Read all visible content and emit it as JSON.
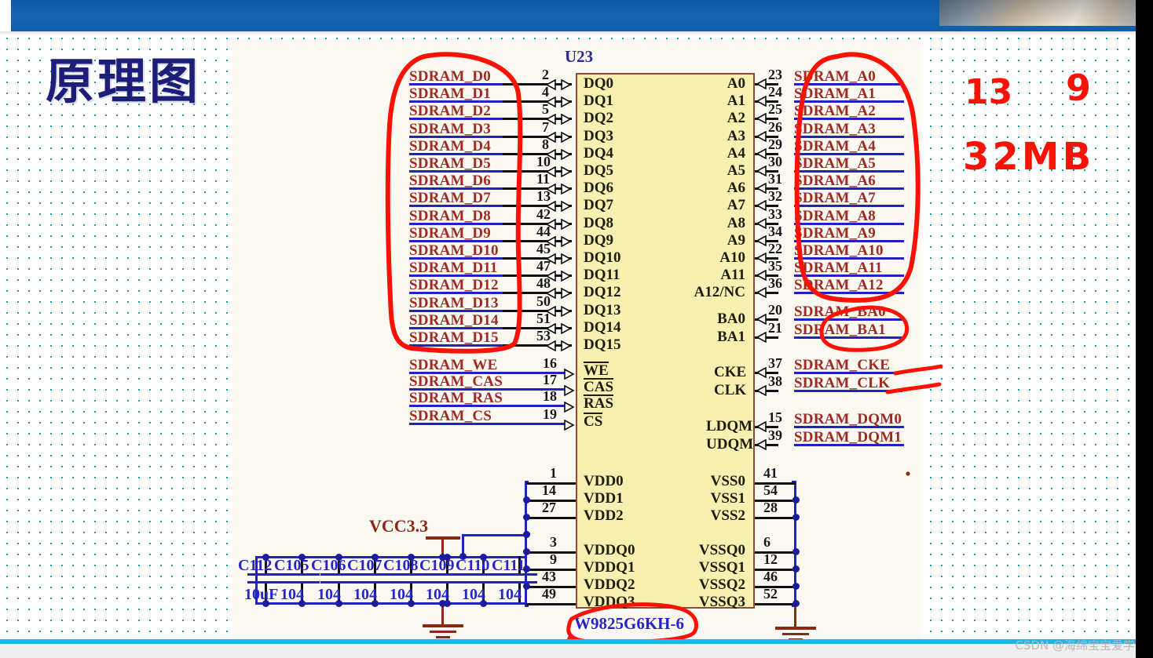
{
  "slide": {
    "title": "原理图",
    "chip_ref": "U23",
    "chip_part": "W9825G6KH-6",
    "power_rail": "VCC3.3",
    "gnd_left": "GND",
    "gnd_right": "GND"
  },
  "watermark": "CSDN @海绵宝宝爱学习",
  "colors": {
    "chip_fill": "#f7f0b0",
    "chip_border": "#8f4a38",
    "net_label": "#9e2a20",
    "wire_blue": "#2222c0",
    "annotation_red": "#fb1205",
    "title_blue": "#1c1e7a",
    "topbar_blue": "#1465b3",
    "progress_blue": "#22b3e8"
  },
  "data_bus": {
    "nets": [
      {
        "label": "SDRAM_D0",
        "pin": "2",
        "name": "DQ0"
      },
      {
        "label": "SDRAM_D1",
        "pin": "4",
        "name": "DQ1"
      },
      {
        "label": "SDRAM_D2",
        "pin": "5",
        "name": "DQ2"
      },
      {
        "label": "SDRAM_D3",
        "pin": "7",
        "name": "DQ3"
      },
      {
        "label": "SDRAM_D4",
        "pin": "8",
        "name": "DQ4"
      },
      {
        "label": "SDRAM_D5",
        "pin": "10",
        "name": "DQ5"
      },
      {
        "label": "SDRAM_D6",
        "pin": "11",
        "name": "DQ6"
      },
      {
        "label": "SDRAM_D7",
        "pin": "13",
        "name": "DQ7"
      },
      {
        "label": "SDRAM_D8",
        "pin": "42",
        "name": "DQ8"
      },
      {
        "label": "SDRAM_D9",
        "pin": "44",
        "name": "DQ9"
      },
      {
        "label": "SDRAM_D10",
        "pin": "45",
        "name": "DQ10"
      },
      {
        "label": "SDRAM_D11",
        "pin": "47",
        "name": "DQ11"
      },
      {
        "label": "SDRAM_D12",
        "pin": "48",
        "name": "DQ12"
      },
      {
        "label": "SDRAM_D13",
        "pin": "50",
        "name": "DQ13"
      },
      {
        "label": "SDRAM_D14",
        "pin": "51",
        "name": "DQ14"
      },
      {
        "label": "SDRAM_D15",
        "pin": "53",
        "name": "DQ15"
      }
    ]
  },
  "address_bus": {
    "nets": [
      {
        "label": "SDRAM_A0",
        "pin": "23",
        "name": "A0"
      },
      {
        "label": "SDRAM_A1",
        "pin": "24",
        "name": "A1"
      },
      {
        "label": "SDRAM_A2",
        "pin": "25",
        "name": "A2"
      },
      {
        "label": "SDRAM_A3",
        "pin": "26",
        "name": "A3"
      },
      {
        "label": "SDRAM_A4",
        "pin": "29",
        "name": "A4"
      },
      {
        "label": "SDRAM_A5",
        "pin": "30",
        "name": "A5"
      },
      {
        "label": "SDRAM_A6",
        "pin": "31",
        "name": "A6"
      },
      {
        "label": "SDRAM_A7",
        "pin": "32",
        "name": "A7"
      },
      {
        "label": "SDRAM_A8",
        "pin": "33",
        "name": "A8"
      },
      {
        "label": "SDRAM_A9",
        "pin": "34",
        "name": "A9"
      },
      {
        "label": "SDRAM_A10",
        "pin": "22",
        "name": "A10"
      },
      {
        "label": "SDRAM_A11",
        "pin": "35",
        "name": "A11"
      },
      {
        "label": "SDRAM_A12",
        "pin": "36",
        "name": "A12/NC"
      }
    ]
  },
  "bank_bus": {
    "nets": [
      {
        "label": "SDRAM_BA0",
        "pin": "20",
        "name": "BA0"
      },
      {
        "label": "SDRAM_BA1",
        "pin": "21",
        "name": "BA1"
      }
    ]
  },
  "control_left": {
    "nets": [
      {
        "label": "SDRAM_WE",
        "pin": "16",
        "name": "WE",
        "overbar": true
      },
      {
        "label": "SDRAM_CAS",
        "pin": "17",
        "name": "CAS",
        "overbar": true
      },
      {
        "label": "SDRAM_RAS",
        "pin": "18",
        "name": "RAS",
        "overbar": true
      },
      {
        "label": "SDRAM_CS",
        "pin": "19",
        "name": "CS",
        "overbar": true
      }
    ]
  },
  "clock_bus": {
    "nets": [
      {
        "label": "SDRAM_CKE",
        "pin": "37",
        "name": "CKE"
      },
      {
        "label": "SDRAM_CLK",
        "pin": "38",
        "name": "CLK"
      }
    ]
  },
  "dqm_bus": {
    "nets": [
      {
        "label": "SDRAM_DQM0",
        "pin": "15",
        "name": "LDQM"
      },
      {
        "label": "SDRAM_DQM1",
        "pin": "39",
        "name": "UDQM"
      }
    ]
  },
  "power_pins": {
    "vdd": [
      {
        "pin": "1",
        "name": "VDD0"
      },
      {
        "pin": "14",
        "name": "VDD1"
      },
      {
        "pin": "27",
        "name": "VDD2"
      },
      {
        "pin": "3",
        "name": "VDDQ0"
      },
      {
        "pin": "9",
        "name": "VDDQ1"
      },
      {
        "pin": "43",
        "name": "VDDQ2"
      },
      {
        "pin": "49",
        "name": "VDDQ3"
      }
    ],
    "vss": [
      {
        "pin": "41",
        "name": "VSS0"
      },
      {
        "pin": "54",
        "name": "VSS1"
      },
      {
        "pin": "28",
        "name": "VSS2"
      },
      {
        "pin": "6",
        "name": "VSSQ0"
      },
      {
        "pin": "12",
        "name": "VSSQ1"
      },
      {
        "pin": "46",
        "name": "VSSQ2"
      },
      {
        "pin": "52",
        "name": "VSSQ3"
      }
    ]
  },
  "capacitors": [
    {
      "ref": "C112",
      "value": "10uF"
    },
    {
      "ref": "C105",
      "value": "104"
    },
    {
      "ref": "C106",
      "value": "104"
    },
    {
      "ref": "C107",
      "value": "104"
    },
    {
      "ref": "C108",
      "value": "104"
    },
    {
      "ref": "C109",
      "value": "104"
    },
    {
      "ref": "C110",
      "value": "104"
    },
    {
      "ref": "C111",
      "value": "104"
    }
  ],
  "annotations": {
    "row_bits": "13",
    "col_bits": "9",
    "capacity": "32MB"
  }
}
